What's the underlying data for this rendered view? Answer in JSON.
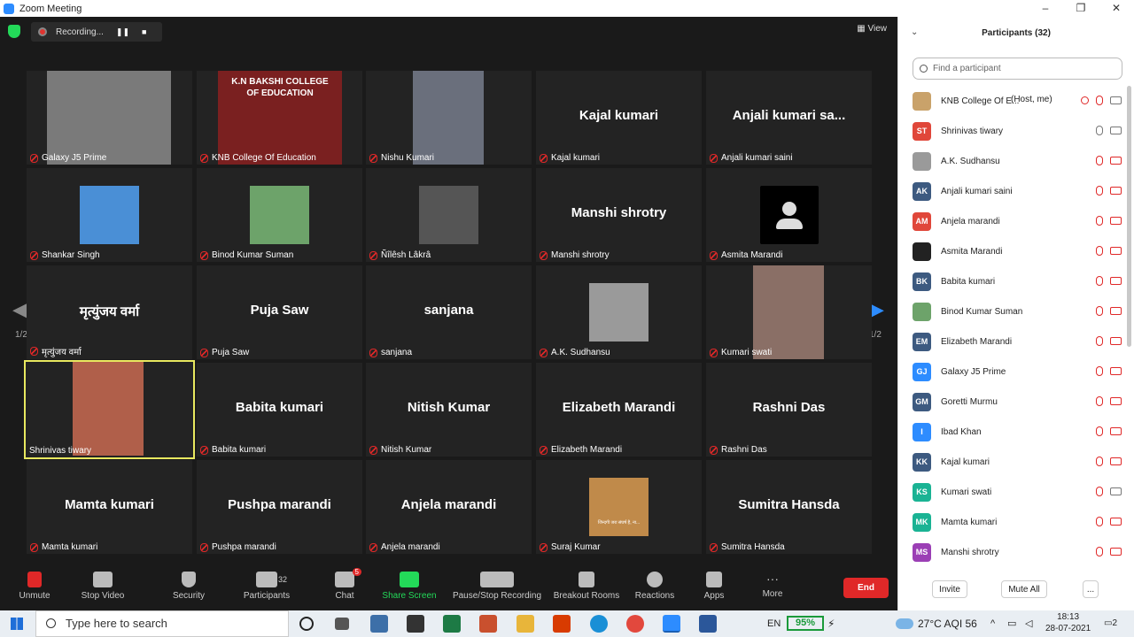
{
  "window": {
    "title": "Zoom Meeting",
    "controls": [
      "–",
      "❐",
      "✕"
    ]
  },
  "recording": {
    "label": "Recording...",
    "pause": "❚❚",
    "stop": "■"
  },
  "view_label": "View",
  "page_indicator": {
    "left": "1/2",
    "right": "1/2"
  },
  "tiles": [
    {
      "name": "Galaxy J5 Prime",
      "type": "video",
      "color": "#7a7a7a"
    },
    {
      "name": "KNB College Of Education",
      "type": "video",
      "color": "#7a2020"
    },
    {
      "name": "Nishu Kumari",
      "type": "video",
      "color": "#6a6f7c"
    },
    {
      "name": "Kajal kumari",
      "big": "Kajal kumari",
      "type": "name"
    },
    {
      "name": "Anjali kumari saini",
      "big": "Anjali kumari sa...",
      "type": "name"
    },
    {
      "name": "Shankar Singh",
      "type": "video",
      "color": "#4a8fd6"
    },
    {
      "name": "Binod Kumar Suman",
      "type": "video",
      "color": "#6da36a"
    },
    {
      "name": "Ñîlêsh Lâkrâ",
      "type": "video",
      "color": "#555555"
    },
    {
      "name": "Manshi shrotry",
      "big": "Manshi shrotry",
      "type": "name"
    },
    {
      "name": "Asmita Marandi",
      "type": "avatar"
    },
    {
      "name": "मृत्युंजय वर्मा",
      "big": "मृत्युंजय वर्मा",
      "type": "name"
    },
    {
      "name": "Puja Saw",
      "big": "Puja Saw",
      "type": "name"
    },
    {
      "name": "sanjana",
      "big": "sanjana",
      "type": "name"
    },
    {
      "name": "A.K. Sudhansu",
      "type": "video",
      "color": "#9a9a9a"
    },
    {
      "name": "Kumari swati",
      "type": "video",
      "color": "#8a6f66"
    },
    {
      "name": "Shrinivas tiwary",
      "type": "video",
      "color": "#b05f4a",
      "active": true
    },
    {
      "name": "Babita kumari",
      "big": "Babita kumari",
      "type": "name"
    },
    {
      "name": "Nitish Kumar",
      "big": "Nitish Kumar",
      "type": "name"
    },
    {
      "name": "Elizabeth Marandi",
      "big": "Elizabeth Marandi",
      "type": "name"
    },
    {
      "name": "Rashni Das",
      "big": "Rashni Das",
      "type": "name"
    },
    {
      "name": "Mamta kumari",
      "big": "Mamta kumari",
      "type": "name"
    },
    {
      "name": "Pushpa marandi",
      "big": "Pushpa marandi",
      "type": "name"
    },
    {
      "name": "Anjela marandi",
      "big": "Anjela marandi",
      "type": "name"
    },
    {
      "name": "Suraj Kumar",
      "type": "video",
      "color": "#c08a4a"
    },
    {
      "name": "Sumitra Hansda",
      "big": "Sumitra Hansda",
      "type": "name"
    }
  ],
  "tile_text": {
    "college_banner": "K.N BAKSHI COLLEGE OF EDUCATION",
    "suraj_caption": "जिन्दगी जरा संघर्ष है, ना..."
  },
  "toolbar": {
    "unmute": "Unmute",
    "stop_video": "Stop Video",
    "security": "Security",
    "participants": "Participants",
    "participants_count": "32",
    "chat": "Chat",
    "chat_badge": "5",
    "share_screen": "Share Screen",
    "recording": "Pause/Stop Recording",
    "breakout": "Breakout Rooms",
    "reactions": "Reactions",
    "apps": "Apps",
    "more": "More",
    "end": "End"
  },
  "panel": {
    "title": "Participants (32)",
    "search_placeholder": "Find a participant",
    "host_tag": "(Host, me)",
    "invite": "Invite",
    "mute_all": "Mute All",
    "more": "...",
    "participants": [
      {
        "name": "KNB College Of E...",
        "initials": "",
        "color": "#c9a26a",
        "mic": "host"
      },
      {
        "name": "Shrinivas tiwary",
        "initials": "ST",
        "color": "#e0473a",
        "mic": "on"
      },
      {
        "name": "A.K. Sudhansu",
        "initials": "",
        "color": "#9a9a9a",
        "mic": "off"
      },
      {
        "name": "Anjali kumari saini",
        "initials": "AK",
        "color": "#3d5a80",
        "mic": "off"
      },
      {
        "name": "Anjela marandi",
        "initials": "AM",
        "color": "#e0473a",
        "mic": "off"
      },
      {
        "name": "Asmita Marandi",
        "initials": "",
        "color": "#222222",
        "mic": "off"
      },
      {
        "name": "Babita kumari",
        "initials": "BK",
        "color": "#3d5a80",
        "mic": "off"
      },
      {
        "name": "Binod Kumar Suman",
        "initials": "",
        "color": "#6da36a",
        "mic": "off"
      },
      {
        "name": "Elizabeth Marandi",
        "initials": "EM",
        "color": "#3d5a80",
        "mic": "off"
      },
      {
        "name": "Galaxy J5 Prime",
        "initials": "GJ",
        "color": "#2d8cff",
        "mic": "off"
      },
      {
        "name": "Goretti Murmu",
        "initials": "GM",
        "color": "#3d5a80",
        "mic": "off"
      },
      {
        "name": "Ibad Khan",
        "initials": "I",
        "color": "#2d8cff",
        "mic": "off"
      },
      {
        "name": "Kajal kumari",
        "initials": "KK",
        "color": "#3d5a80",
        "mic": "off"
      },
      {
        "name": "Kumari swati",
        "initials": "KS",
        "color": "#1ab394",
        "mic": "off-camon"
      },
      {
        "name": "Mamta kumari",
        "initials": "MK",
        "color": "#1ab394",
        "mic": "off"
      },
      {
        "name": "Manshi shrotry",
        "initials": "MS",
        "color": "#9b3fb5",
        "mic": "off"
      }
    ]
  },
  "taskbar": {
    "search": "Type here to search",
    "lang": "EN",
    "battery": "95%",
    "weather": "27°C  AQI 56",
    "time": "18:13",
    "date": "28-07-2021",
    "notifications": "2"
  }
}
